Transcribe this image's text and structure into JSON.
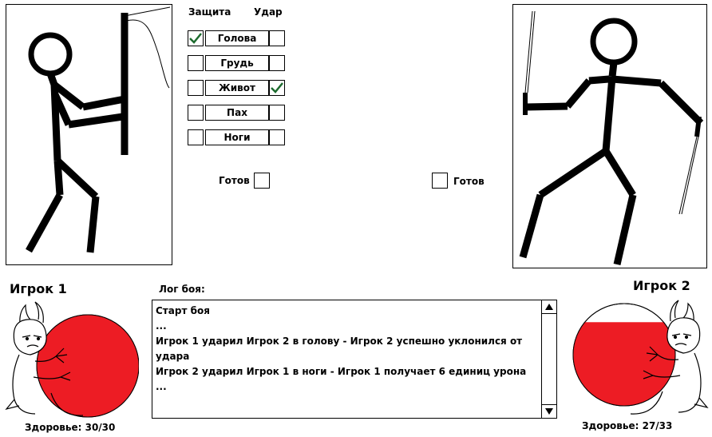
{
  "columns": {
    "defense": "Защита",
    "attack": "Удар"
  },
  "zones": [
    {
      "label": "Голова",
      "defense": true,
      "attack": false
    },
    {
      "label": "Грудь",
      "defense": false,
      "attack": false
    },
    {
      "label": "Живот",
      "defense": false,
      "attack": true
    },
    {
      "label": "Пах",
      "defense": false,
      "attack": false
    },
    {
      "label": "Ноги",
      "defense": false,
      "attack": false
    }
  ],
  "ready": {
    "p1_label": "Готов",
    "p2_label": "Готов",
    "p1_checked": false,
    "p2_checked": false
  },
  "players": [
    {
      "name": "Игрок 1",
      "health_text": "Здоровье: 30/30",
      "hp": 30,
      "hp_max": 30,
      "color": "#ed1c24"
    },
    {
      "name": "Игрок 2",
      "health_text": "Здоровье: 27/33",
      "hp": 27,
      "hp_max": 33,
      "color": "#ed1c24"
    }
  ],
  "log": {
    "title": "Лог боя:",
    "lines": [
      "Старт боя",
      "...",
      "Игрок 1 ударил Игрок 2 в голову - Игрок 2 успешно уклонился от",
      "удара",
      "Игрок 2 ударил Игрок 1 в ноги - Игрок 1 получает 6 единиц урона",
      "..."
    ]
  },
  "check_color": "#1d6b2e"
}
